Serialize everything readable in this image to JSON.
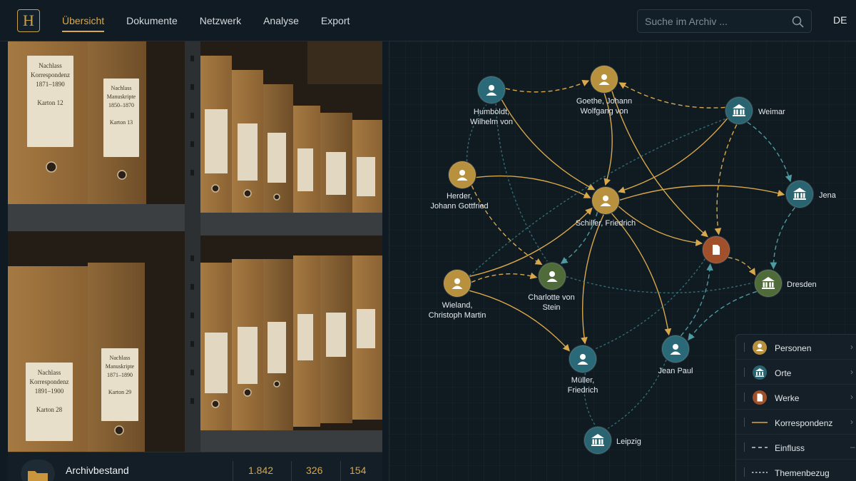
{
  "header": {
    "logo_letter": "H",
    "nav": [
      "Übersicht",
      "Dokumente",
      "Netzwerk",
      "Analyse",
      "Export"
    ],
    "active_nav": "Übersicht",
    "search_placeholder": "Suche im Archiv ...",
    "language": "DE"
  },
  "photo": {
    "labels": [
      {
        "text": "Nachlass\nKorrespondenz\n1871–1890\n\nKarton 12"
      },
      {
        "text": "Nachlass\nManuskripte\n1850–1870\n\nKarton 13"
      },
      {
        "text": "Nachlass\nKorrespondenz\n1891–1900\n\nKarton 28"
      },
      {
        "text": "Nachlass\nManuskripte\n1871–1890\n\nKarton 29"
      }
    ]
  },
  "info_bar": {
    "title": "Archivbestand",
    "stats": [
      "1.842",
      "326",
      "154"
    ]
  },
  "network": {
    "nodes": [
      {
        "id": "humboldt",
        "type": "person",
        "label": "Humboldt,\nWilhelm von"
      },
      {
        "id": "goethe",
        "type": "person",
        "label": "Goethe, Johann\nWolfgang von"
      },
      {
        "id": "weimar",
        "type": "place",
        "label": "Weimar"
      },
      {
        "id": "herder",
        "type": "person",
        "label": "Herder,\nJohann Gottfried"
      },
      {
        "id": "schiller",
        "type": "person",
        "label": "Schiller, Friedrich"
      },
      {
        "id": "jena",
        "type": "place",
        "label": "Jena"
      },
      {
        "id": "werk",
        "type": "work",
        "label": ""
      },
      {
        "id": "wieland",
        "type": "person",
        "label": "Wieland,\nChristoph Martin"
      },
      {
        "id": "stein",
        "type": "person",
        "label": "Charlotte von\nStein"
      },
      {
        "id": "dresden",
        "type": "place",
        "label": "Dresden"
      },
      {
        "id": "jeanpaul",
        "type": "person",
        "label": "Jean Paul"
      },
      {
        "id": "mueller",
        "type": "person",
        "label": "Müller,\nFriedrich"
      },
      {
        "id": "leipzig",
        "type": "place",
        "label": "Leipzig"
      }
    ],
    "colors": {
      "person_gold": "#b8913f",
      "person_teal": "#2a6a78",
      "person_green": "#4f6b3a",
      "place": "#2a6470",
      "work": "#a0512b",
      "correspondence": "#d9a84b",
      "influence": "#4d9aa0",
      "theme": "#3e7f8a"
    }
  },
  "legend": {
    "items": [
      {
        "label": "Personen",
        "icon": "person-icon"
      },
      {
        "label": "Orte",
        "icon": "building-icon"
      },
      {
        "label": "Werke",
        "icon": "document-icon"
      },
      {
        "label": "Korrespondenz",
        "icon": "solid-line"
      },
      {
        "label": "Einfluss",
        "icon": "dashed-line"
      },
      {
        "label": "Themenbezug",
        "icon": "dotted-line"
      }
    ]
  }
}
